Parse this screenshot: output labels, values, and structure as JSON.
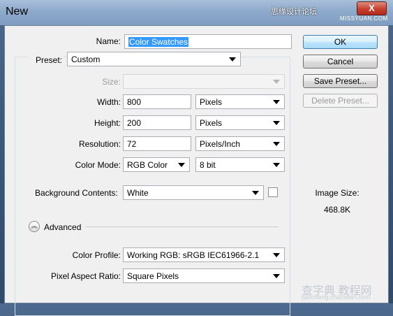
{
  "window": {
    "title": "New",
    "watermark": "思缘设计论坛",
    "close_glyph": "X",
    "close_sub": "MISSYUAN.COM"
  },
  "name": {
    "label": "Name:",
    "value": "Color Swatches"
  },
  "preset": {
    "label": "Preset:",
    "value": "Custom"
  },
  "size": {
    "label": "Size:",
    "value": ""
  },
  "width": {
    "label": "Width:",
    "value": "800",
    "unit": "Pixels"
  },
  "height": {
    "label": "Height:",
    "value": "200",
    "unit": "Pixels"
  },
  "resolution": {
    "label": "Resolution:",
    "value": "72",
    "unit": "Pixels/Inch"
  },
  "color_mode": {
    "label": "Color Mode:",
    "value": "RGB Color",
    "depth": "8 bit"
  },
  "background": {
    "label": "Background Contents:",
    "value": "White"
  },
  "advanced": {
    "label": "Advanced"
  },
  "color_profile": {
    "label": "Color Profile:",
    "value": "Working RGB:  sRGB IEC61966-2.1"
  },
  "pixel_aspect": {
    "label": "Pixel Aspect Ratio:",
    "value": "Square Pixels"
  },
  "buttons": {
    "ok": "OK",
    "cancel": "Cancel",
    "save_preset": "Save Preset...",
    "delete_preset": "Delete Preset..."
  },
  "image_size": {
    "label": "Image Size:",
    "value": "468.8K"
  },
  "bottom_watermark": {
    "main": "查字典 教程网",
    "sub": "jiaocheng.chazidian.com"
  },
  "colors": {
    "selection": "#3399ff",
    "dialog_bg": "#f0f0f0"
  }
}
